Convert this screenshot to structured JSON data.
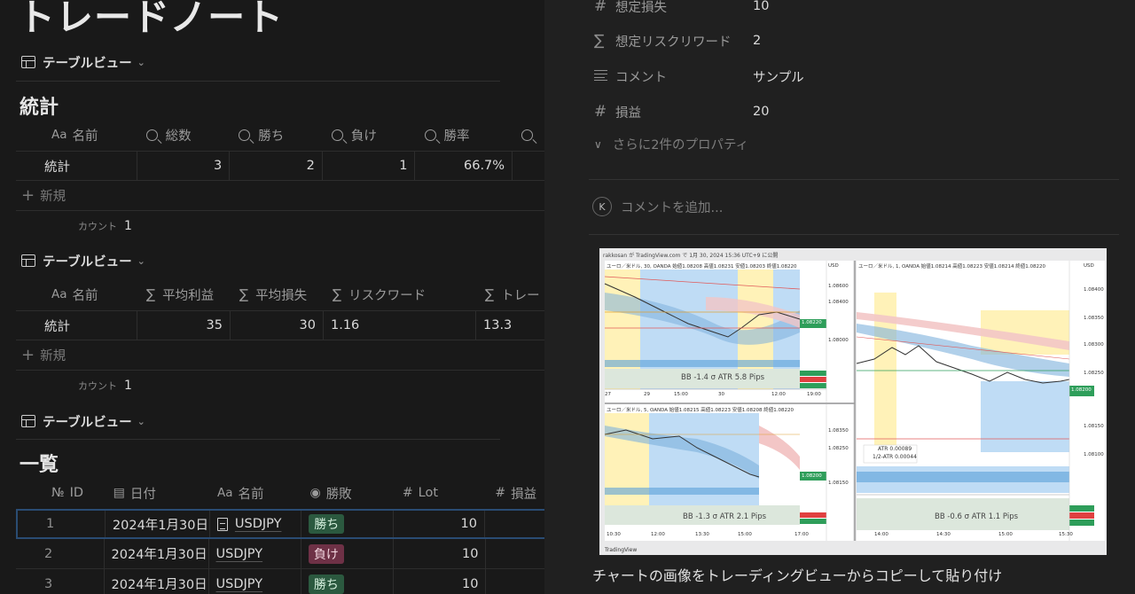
{
  "page": {
    "title": "トレードノート"
  },
  "views": [
    {
      "label": "テーブルビュー"
    },
    {
      "label": "テーブルビュー"
    },
    {
      "label": "テーブルビュー"
    }
  ],
  "stats1": {
    "title": "統計",
    "headers": [
      "名前",
      "総数",
      "勝ち",
      "負け",
      "勝率",
      ""
    ],
    "row": [
      "統計",
      "3",
      "2",
      "1",
      "66.7%"
    ],
    "new_label": "新規",
    "count_label": "カウント",
    "count_value": "1"
  },
  "stats2": {
    "headers": [
      "名前",
      "平均利益",
      "平均損失",
      "リスクワード",
      "トレー"
    ],
    "row": [
      "統計",
      "35",
      "30",
      "1.16",
      "13.3"
    ],
    "new_label": "新規",
    "count_label": "カウント",
    "count_value": "1"
  },
  "list": {
    "title": "一覧",
    "headers": [
      "ID",
      "日付",
      "名前",
      "勝敗",
      "Lot",
      "損益"
    ],
    "rows": [
      {
        "id": "1",
        "date": "2024年1月30日",
        "name": "USDJPY",
        "result": "勝ち",
        "lot": "10"
      },
      {
        "id": "2",
        "date": "2024年1月30日",
        "name": "USDJPY",
        "result": "負け",
        "lot": "10"
      },
      {
        "id": "3",
        "date": "2024年1月30日",
        "name": "USDJPY",
        "result": "勝ち",
        "lot": "10"
      }
    ]
  },
  "props": [
    {
      "icon": "hash-icon",
      "name": "想定損失",
      "value": "10"
    },
    {
      "icon": "sigma-icon",
      "name": "想定リスクリワード",
      "value": "2"
    },
    {
      "icon": "lines-icon",
      "name": "コメント",
      "value": "サンプル"
    },
    {
      "icon": "hash-icon",
      "name": "損益",
      "value": "20"
    }
  ],
  "more_props": "さらに2件のプロパティ",
  "comment": {
    "avatar": "K",
    "placeholder": "コメントを追加..."
  },
  "chart": {
    "header": "rakkosan が TradingView.com で 1月 30, 2024 15:36 UTC+9 に公開",
    "footer": "TradingView",
    "panels": [
      {
        "title": "ユーロ／米ドル, 30, OANDA 始値1.08208 高値1.08231 安値1.08203 終値1.08220",
        "label": "BB -1.4 σ   ATR 5.8 Pips",
        "x_ticks": [
          "27",
          "29",
          "15:00",
          "30",
          "12:00",
          "19:00"
        ]
      },
      {
        "title": "ユーロ／米ドル, 1, OANDA 始値1.08214 高値1.08223 安値1.08214 終値1.08220",
        "label": "BB -0.6 σ   ATR 1.1 Pips",
        "x_ticks": [
          "14:00",
          "14:30",
          "15:00",
          "15:30"
        ]
      },
      {
        "title": "ユーロ／米ドル, 5, OANDA 始値1.08215 高値1.08223 安値1.08208 終値1.08220",
        "label": "BB -1.3 σ   ATR 2.1 Pips",
        "x_ticks": [
          "10:30",
          "12:00",
          "13:30",
          "15:00",
          "17:00"
        ]
      }
    ],
    "atr_box": {
      "atr": "ATR    0.00089",
      "half": "1/2-ATR   0.00044"
    },
    "price_ticks_a": [
      "1.08600",
      "1.08400",
      "1.08220",
      "1.08000"
    ],
    "price_ticks_b": [
      "1.08400",
      "1.08350",
      "1.08300",
      "1.08250",
      "1.08200",
      "1.08150",
      "1.08100"
    ],
    "price_ticks_c": [
      "1.08350",
      "1.08250",
      "1.08200",
      "1.08150"
    ],
    "currency": "USD",
    "colors": {
      "band_yellow": "#fff2b8",
      "band_blue": "#bfdcf5",
      "cloud_red": "#f3c6c6",
      "price_green": "#2e9e5a"
    }
  },
  "caption": "チャートの画像をトレーディングビューからコピーして貼り付け"
}
